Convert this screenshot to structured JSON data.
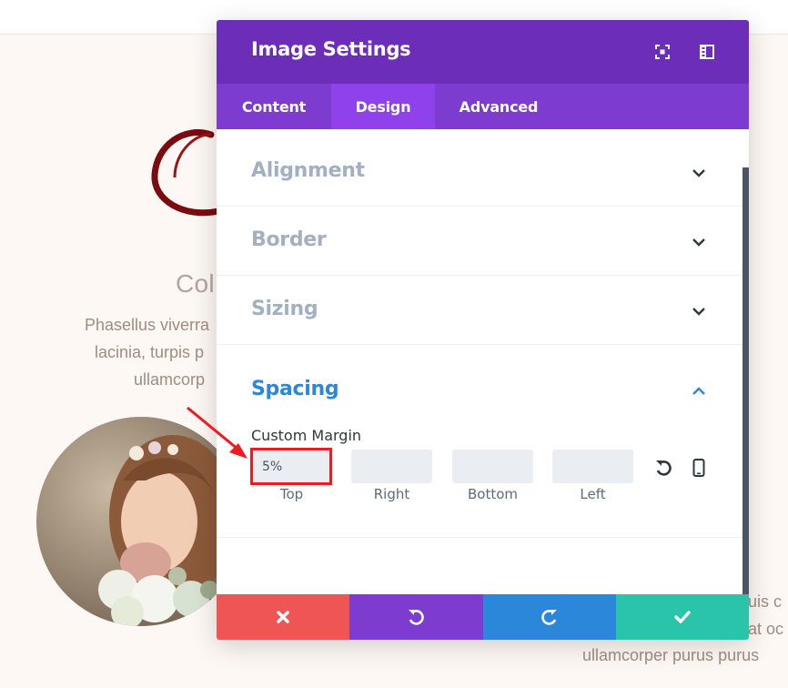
{
  "background": {
    "heading": "Col",
    "lines": [
      "Phasellus viverra",
      "lacinia, turpis p",
      "ullamcorp"
    ],
    "right_lines": [
      "uis c",
      "at oc",
      "ullamcorper purus purus"
    ]
  },
  "modal": {
    "title": "Image Settings",
    "header_icons": [
      "screenshot-icon",
      "sidebar-layout-icon"
    ],
    "tabs": [
      {
        "label": "Content",
        "active": false
      },
      {
        "label": "Design",
        "active": true
      },
      {
        "label": "Advanced",
        "active": false
      }
    ],
    "sections": [
      {
        "label": "Alignment",
        "open": false
      },
      {
        "label": "Border",
        "open": false
      },
      {
        "label": "Sizing",
        "open": false
      },
      {
        "label": "Spacing",
        "open": true
      }
    ],
    "custom_margin": {
      "label": "Custom Margin",
      "fields": [
        {
          "label": "Top",
          "value": "5%"
        },
        {
          "label": "Right",
          "value": ""
        },
        {
          "label": "Bottom",
          "value": ""
        },
        {
          "label": "Left",
          "value": ""
        }
      ]
    },
    "footer_buttons": [
      {
        "name": "discard",
        "icon": "close-icon",
        "color": "#ef5555"
      },
      {
        "name": "undo",
        "icon": "undo-icon",
        "color": "#7e3bd0"
      },
      {
        "name": "redo",
        "icon": "redo-icon",
        "color": "#2b87da"
      },
      {
        "name": "save",
        "icon": "check-icon",
        "color": "#29c4a9"
      }
    ]
  },
  "colors": {
    "header": "#6c2eb9",
    "tabs": "#7d3bcf",
    "active_tab": "#8f42ec",
    "accent": "#2b87da",
    "highlight": "#ee1b22"
  }
}
